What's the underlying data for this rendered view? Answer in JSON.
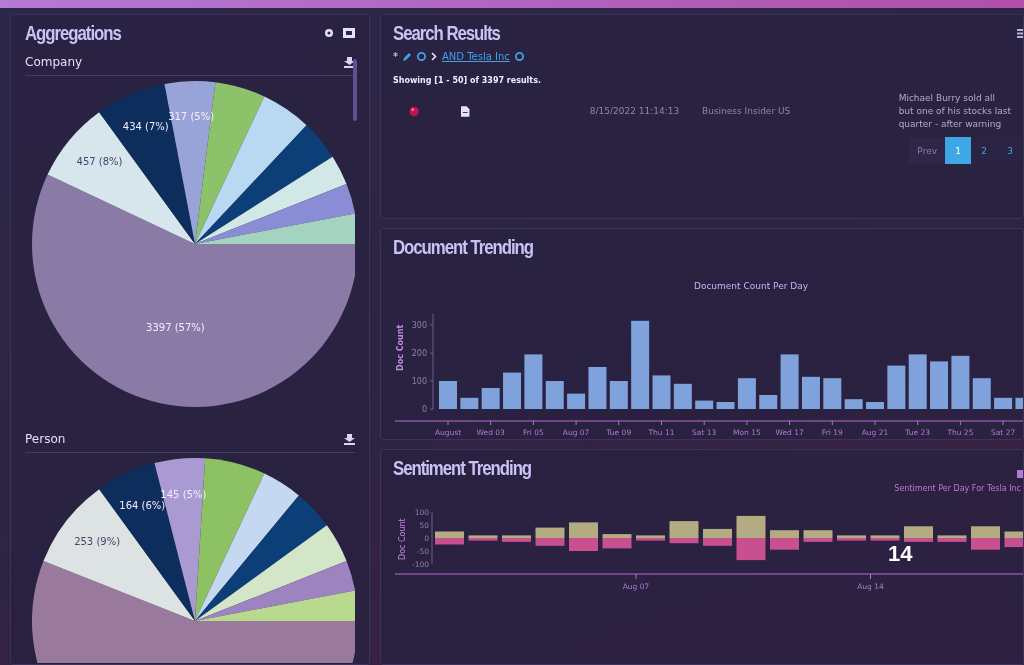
{
  "aggregations": {
    "title": "Aggregations",
    "sections": [
      {
        "title": "Company",
        "chart_data": {
          "type": "pie",
          "values": [
            57,
            8,
            7,
            5,
            5,
            5,
            4,
            3,
            3,
            3
          ],
          "value_labels": [
            "3397 (57%)",
            "457 (8%)",
            "434 (7%)",
            "317 (5%)",
            null,
            null,
            null,
            null,
            null,
            null
          ],
          "colors": [
            "#8a7aa6",
            "#d7e6ec",
            "#0d2e5c",
            "#98a4d8",
            "#8cc26a",
            "#b9d8f2",
            "#0c3f78",
            "#d2e8e6",
            "#8a8cd6",
            "#a4d4c0"
          ]
        }
      },
      {
        "title": "Person",
        "chart_data": {
          "type": "pie",
          "values": [
            56,
            9,
            6,
            5,
            6,
            4,
            4,
            4,
            3,
            3
          ],
          "value_labels": [
            null,
            "253 (9%)",
            "164 (6%)",
            "145 (5%)",
            null,
            null,
            null,
            null,
            null,
            null
          ],
          "colors": [
            "#9a7a9c",
            "#dde3e3",
            "#0d2e5c",
            "#a99ad2",
            "#8cc263",
            "#c5d8f2",
            "#0c3f78",
            "#d4e6c8",
            "#9d84c0",
            "#b8d98e"
          ]
        }
      }
    ]
  },
  "search_results": {
    "title": "Search Results",
    "breadcrumb": {
      "root": "*",
      "query": "AND Tesla Inc"
    },
    "summary": "Showing [1 - 50] of 3397 results.",
    "result": {
      "date": "8/15/2022 11:14:13",
      "source": "Business Insider US",
      "snippet_lines": [
        "Michael Burry sold all",
        "but one of his stocks last",
        "quarter - after warning"
      ]
    },
    "pagination": [
      {
        "label": "Prev",
        "selected": false,
        "disabled": true
      },
      {
        "label": "1",
        "selected": true,
        "disabled": false
      },
      {
        "label": "2",
        "selected": false,
        "disabled": false
      },
      {
        "label": "3",
        "selected": false,
        "disabled": false
      }
    ]
  },
  "document_trending": {
    "title": "Document Trending",
    "chart_data": {
      "type": "bar",
      "title": "Document Count Per Day",
      "ylabel": "Doc Count",
      "categories": [
        "August",
        null,
        "Wed 03",
        null,
        "Fri 05",
        null,
        "Aug 07",
        null,
        "Tue 09",
        null,
        "Thu 11",
        null,
        "Sat 13",
        null,
        "Mon 15",
        null,
        "Wed 17",
        null,
        "Fri 19",
        null,
        "Aug 21",
        null,
        "Tue 23",
        null,
        "Thu 25",
        null,
        "Sat 27",
        null
      ],
      "values": [
        100,
        40,
        75,
        130,
        195,
        100,
        55,
        150,
        100,
        315,
        120,
        90,
        30,
        25,
        110,
        50,
        195,
        115,
        110,
        35,
        25,
        155,
        195,
        170,
        190,
        110,
        40,
        40
      ],
      "ylim": [
        0,
        340
      ],
      "yticks": [
        0,
        100,
        200,
        300
      ]
    }
  },
  "sentiment_trending": {
    "title": "Sentiment Trending",
    "chart_data": {
      "type": "bar",
      "title": "Sentiment Per Day For Tesla Inc",
      "ylabel": "Doc Count",
      "stacked": true,
      "categories": [
        null,
        null,
        null,
        null,
        null,
        null,
        "Aug 07",
        null,
        null,
        null,
        null,
        null,
        null,
        "Aug 14",
        null,
        null,
        null,
        null
      ],
      "series": [
        {
          "color": "#b3ab82",
          "values": [
            25,
            10,
            10,
            40,
            60,
            15,
            10,
            65,
            35,
            85,
            30,
            30,
            10,
            10,
            45,
            10,
            45,
            25
          ]
        },
        {
          "color": "#c8508f",
          "values": [
            -25,
            -10,
            -15,
            -30,
            -50,
            -40,
            -10,
            -20,
            -30,
            -85,
            -45,
            -15,
            -10,
            -10,
            -15,
            -15,
            -45,
            -35
          ]
        }
      ],
      "ylim": [
        -100,
        100
      ],
      "yticks": [
        100,
        50,
        0,
        -50,
        -100
      ]
    }
  },
  "page_number": "14"
}
